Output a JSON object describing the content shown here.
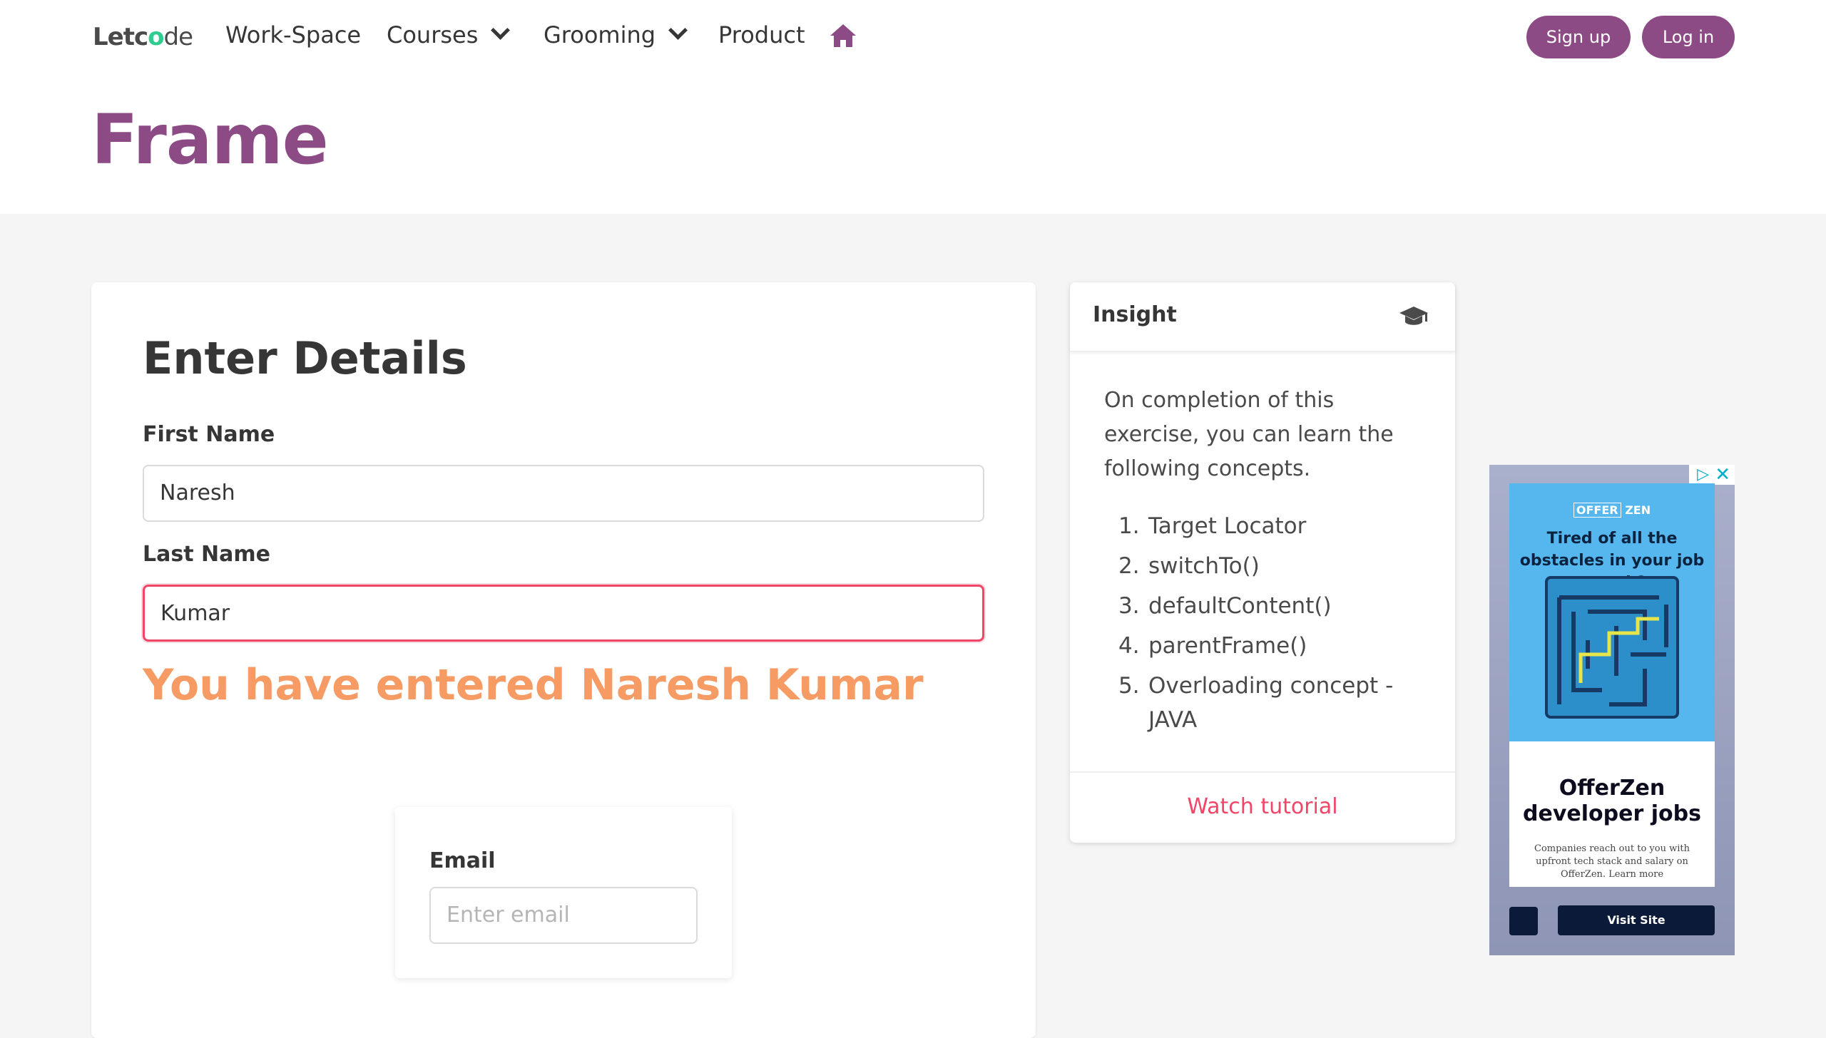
{
  "nav": {
    "logo_prefix": "Letc",
    "logo_o": "o",
    "logo_suffix": "de",
    "items": [
      "Work-Space",
      "Courses",
      "Grooming",
      "Product"
    ],
    "signup": "Sign up",
    "login": "Log in"
  },
  "page": {
    "title": "Frame"
  },
  "form": {
    "heading": "Enter Details",
    "first_label": "First Name",
    "first_value": "Naresh",
    "last_label": "Last Name",
    "last_value": "Kumar",
    "message": "You have entered Naresh Kumar",
    "email_label": "Email",
    "email_placeholder": "Enter email"
  },
  "insight": {
    "title": "Insight",
    "intro": "On completion of this exercise, you can learn the following concepts.",
    "items": [
      "Target Locator",
      "switchTo()",
      "defaultContent()",
      "parentFrame()",
      "Overloading concept - JAVA"
    ],
    "footer": "Watch tutorial"
  },
  "ad": {
    "brand_a": "OFFER",
    "brand_b": "ZEN",
    "headline": "Tired of all the obstacles in your job search?",
    "title": "OfferZen developer jobs",
    "desc": "Companies reach out to you with upfront tech stack and salary on OfferZen. Learn more",
    "cta": "Visit Site"
  },
  "colors": {
    "brand": "#8c4b85",
    "danger": "#f14668",
    "message": "#f79b64"
  }
}
